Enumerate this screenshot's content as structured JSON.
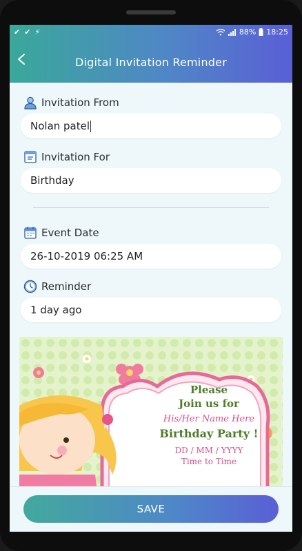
{
  "statusbar": {
    "battery": "88%",
    "time": "18:25"
  },
  "header": {
    "title": "Digital Invitation Reminder"
  },
  "form": {
    "from_label": "Invitation From",
    "from_value": "Nolan patel",
    "for_label": "Invitation For",
    "for_value": "Birthday",
    "date_label": "Event Date",
    "date_value": "26-10-2019 06:25 AM",
    "reminder_label": "Reminder",
    "reminder_value": "1 day ago"
  },
  "invitation_card": {
    "line1": "Please",
    "line2": "Join us for",
    "line3": "His/Her Name Here",
    "line4": "Birthday Party !",
    "line5": "DD / MM / YYYY",
    "line6": "Time to Time"
  },
  "actions": {
    "save_label": "SAVE"
  },
  "colors": {
    "accent_start": "#3aa89a",
    "accent_end": "#5a5fd6",
    "background": "#eef8fb"
  }
}
